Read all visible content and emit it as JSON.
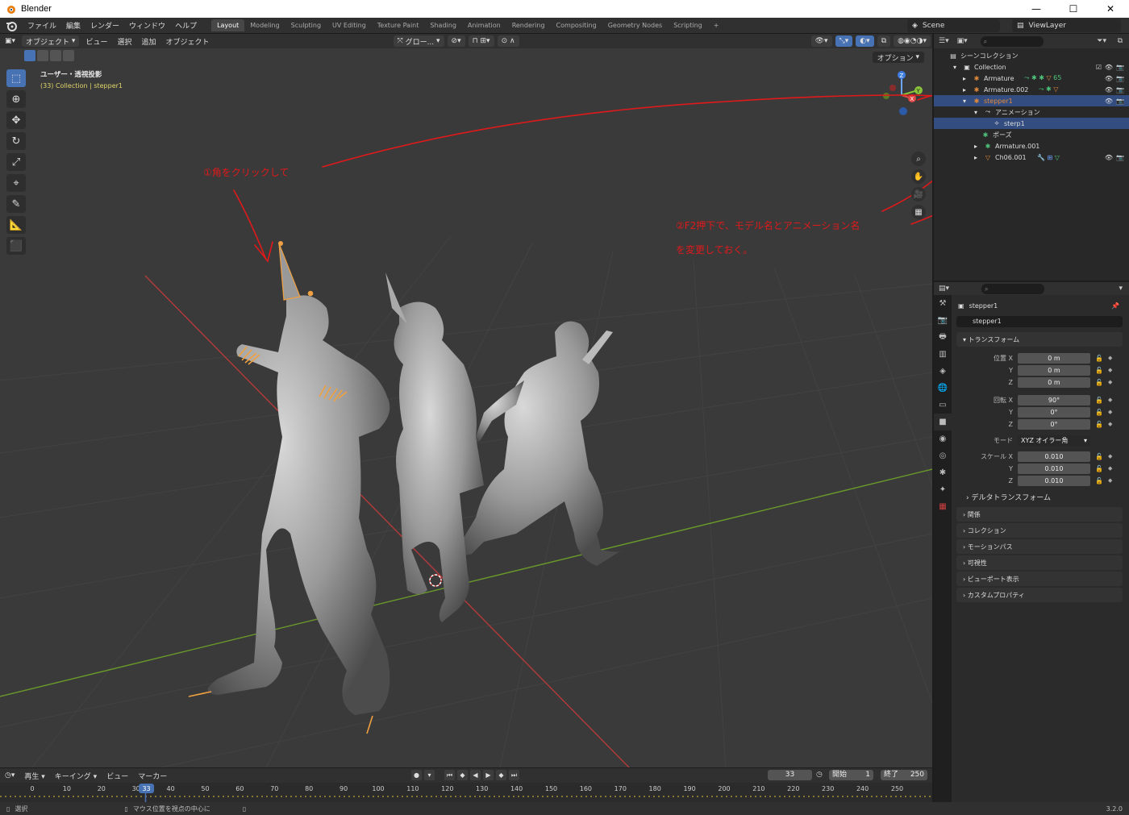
{
  "window": {
    "title": "Blender",
    "min": "—",
    "max": "☐",
    "close": "✕"
  },
  "menu": [
    "ファイル",
    "編集",
    "レンダー",
    "ウィンドウ",
    "ヘルプ"
  ],
  "workspaces": [
    "Layout",
    "Modeling",
    "Sculpting",
    "UV Editing",
    "Texture Paint",
    "Shading",
    "Animation",
    "Rendering",
    "Compositing",
    "Geometry Nodes",
    "Scripting",
    "+"
  ],
  "active_workspace": "Layout",
  "scene": "Scene",
  "view_layer": "ViewLayer",
  "viewport": {
    "mode": "オブジェクト",
    "menus": [
      "ビュー",
      "選択",
      "追加",
      "オブジェクト"
    ],
    "transform_orientation": "グロー...",
    "options": "オプション",
    "info_line1": "ユーザー・透視投影",
    "info_line2": "(33) Collection | stepper1",
    "annotation1": "①角をクリックして",
    "annotation2_line1": "②F2押下で、モデル名とアニメーション名",
    "annotation2_line2": "を変更しておく。",
    "gizmo": {
      "z": "Z",
      "y": "Y",
      "x": "X"
    },
    "colors": {
      "annotation": "#e0191b",
      "bones": "#f0a040",
      "grid_x": "#b53a3a",
      "grid_y": "#6a9a2a"
    }
  },
  "outliner": {
    "search_placeholder": "",
    "rows": [
      {
        "label": "シーンコレクション",
        "indent": 0
      },
      {
        "label": "Collection",
        "indent": 1
      },
      {
        "label": "Armature",
        "indent": 2
      },
      {
        "label": "Armature.002",
        "indent": 2
      },
      {
        "label": "stepper1",
        "indent": 2
      },
      {
        "label": "アニメーション",
        "indent": 3
      },
      {
        "label": "sterp1",
        "indent": 4
      },
      {
        "label": "ポーズ",
        "indent": 3
      },
      {
        "label": "Armature.001",
        "indent": 3
      },
      {
        "label": "Ch06.001",
        "indent": 3
      }
    ],
    "badge": "65"
  },
  "properties": {
    "object_name": "stepper1",
    "object_field": "stepper1",
    "transform_header": "トランスフォーム",
    "location": {
      "label": "位置 X",
      "x": "0 m",
      "y": "0 m",
      "z": "0 m"
    },
    "rotation": {
      "label": "回転 X",
      "x": "90°",
      "y": "0°",
      "z": "0°"
    },
    "mode_label": "モード",
    "mode_value": "XYZ オイラー角",
    "scale": {
      "label": "スケール X",
      "x": "0.010",
      "y": "0.010",
      "z": "0.010"
    },
    "axis_y": "Y",
    "axis_z": "Z",
    "delta": "デルタトランスフォーム",
    "panels": [
      "関係",
      "コレクション",
      "モーションパス",
      "可視性",
      "ビューポート表示",
      "カスタムプロパティ"
    ]
  },
  "timeline": {
    "menus": [
      "再生",
      "キーイング",
      "ビュー",
      "マーカー"
    ],
    "current_frame": "33",
    "start_label": "開始",
    "start": "1",
    "end_label": "終了",
    "end": "250",
    "ticks": [
      "0",
      "10",
      "20",
      "30",
      "40",
      "50",
      "60",
      "70",
      "80",
      "90",
      "100",
      "110",
      "120",
      "130",
      "140",
      "150",
      "160",
      "170",
      "180",
      "190",
      "200",
      "210",
      "220",
      "230",
      "240",
      "250"
    ],
    "playhead": "33"
  },
  "status": {
    "select": "選択",
    "center": "マウス位置を視点の中心に",
    "version": "3.2.0"
  }
}
